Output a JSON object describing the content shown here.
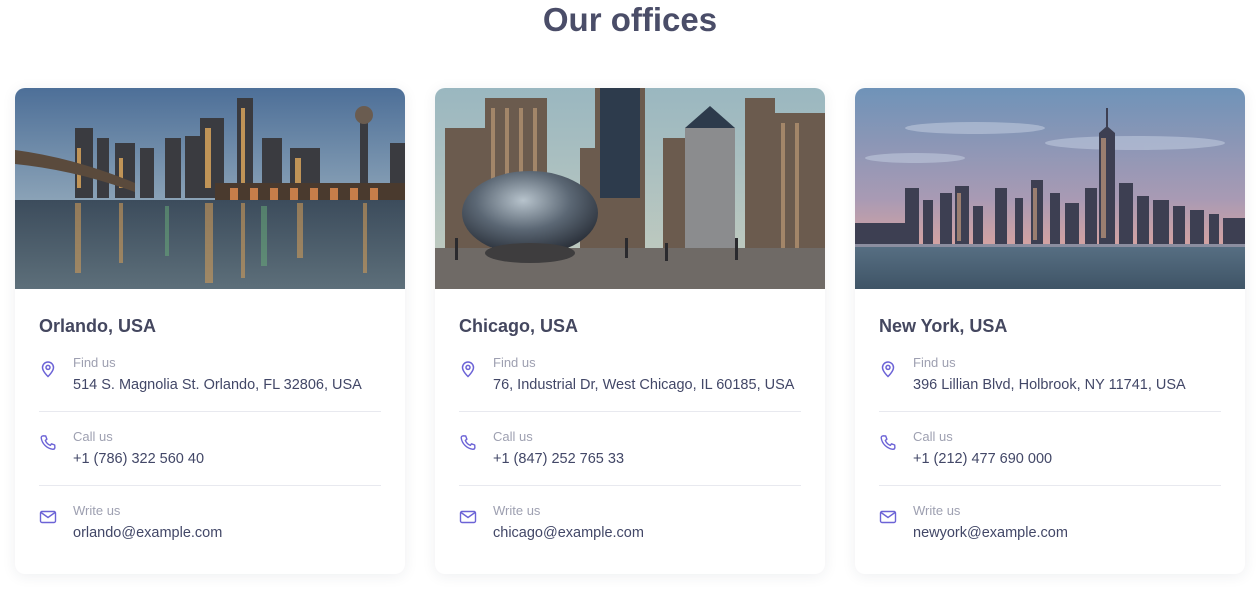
{
  "section_title": "Our offices",
  "labels": {
    "find": "Find us",
    "call": "Call us",
    "write": "Write us"
  },
  "colors": {
    "accent": "#6c63d6",
    "title": "#4a4d68",
    "muted": "#9ea0b1"
  },
  "offices": [
    {
      "city": "Orlando, USA",
      "address": "514 S. Magnolia St. Orlando, FL 32806, USA",
      "phone": "+1 (786) 322 560 40",
      "email": "orlando@example.com",
      "photo": "city-skyline-river-night"
    },
    {
      "city": "Chicago, USA",
      "address": "76, Industrial Dr, West Chicago, IL 60185, USA",
      "phone": "+1 (847) 252 765 33",
      "email": "chicago@example.com",
      "photo": "city-bean-sculpture"
    },
    {
      "city": "New York, USA",
      "address": "396 Lillian Blvd, Holbrook, NY 11741, USA",
      "phone": "+1 (212) 477 690 000",
      "email": "newyork@example.com",
      "photo": "city-skyline-harbor-dusk"
    }
  ]
}
